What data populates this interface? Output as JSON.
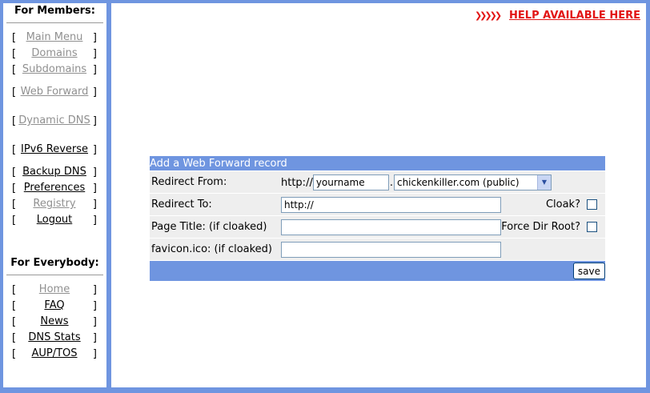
{
  "sidebar": {
    "members_heading": "For Members:",
    "members_items": [
      {
        "label": "Main Menu",
        "style": "gray",
        "lines": 1
      },
      {
        "label": "Domains",
        "style": "gray",
        "lines": 1
      },
      {
        "label": "Subdomains",
        "style": "gray",
        "lines": 1
      },
      {
        "label": "Web Forward",
        "style": "gray",
        "lines": 2
      },
      {
        "label": "Dynamic DNS",
        "style": "gray",
        "lines": 2
      },
      {
        "label": "IPv6 Reverse",
        "style": "black",
        "lines": 2
      },
      {
        "label": "Backup DNS",
        "style": "black",
        "lines": 1
      },
      {
        "label": "Preferences",
        "style": "black",
        "lines": 1
      },
      {
        "label": "Registry",
        "style": "gray",
        "lines": 1
      },
      {
        "label": "Logout",
        "style": "black",
        "lines": 1
      }
    ],
    "everybody_heading": "For Everybody:",
    "everybody_items": [
      {
        "label": "Home",
        "style": "gray",
        "lines": 1
      },
      {
        "label": "FAQ",
        "style": "black",
        "lines": 1
      },
      {
        "label": "News",
        "style": "black",
        "lines": 1
      },
      {
        "label": "DNS Stats",
        "style": "black",
        "lines": 1
      },
      {
        "label": "AUP/TOS",
        "style": "black",
        "lines": 1
      }
    ],
    "bracket_open": "[",
    "bracket_close": "]"
  },
  "help": {
    "label": "HELP AVAILABLE HERE",
    "arrows_icon": "red-chevrons-icon",
    "arrows_glyph": "❯❯❯❯❯",
    "color": "#e21414"
  },
  "form": {
    "title": "Add a Web Forward record",
    "redirect_from_label": "Redirect From:",
    "http_prefix": "http://",
    "subdomain_value": "yourname",
    "dot": ".",
    "domain_selected": "chickenkiller.com (public)",
    "redirect_to_label": "Redirect To:",
    "redirect_to_value": "http://",
    "cloak_label": "Cloak?",
    "page_title_label": "Page Title: (if cloaked)",
    "page_title_value": "",
    "force_dir_root_label": "Force Dir Root?",
    "favicon_label": "favicon.ico: (if cloaked)",
    "favicon_value": "",
    "save_label": "save"
  },
  "colors": {
    "frame_blue": "#6f95e0",
    "row_gray": "#eeeeee"
  }
}
